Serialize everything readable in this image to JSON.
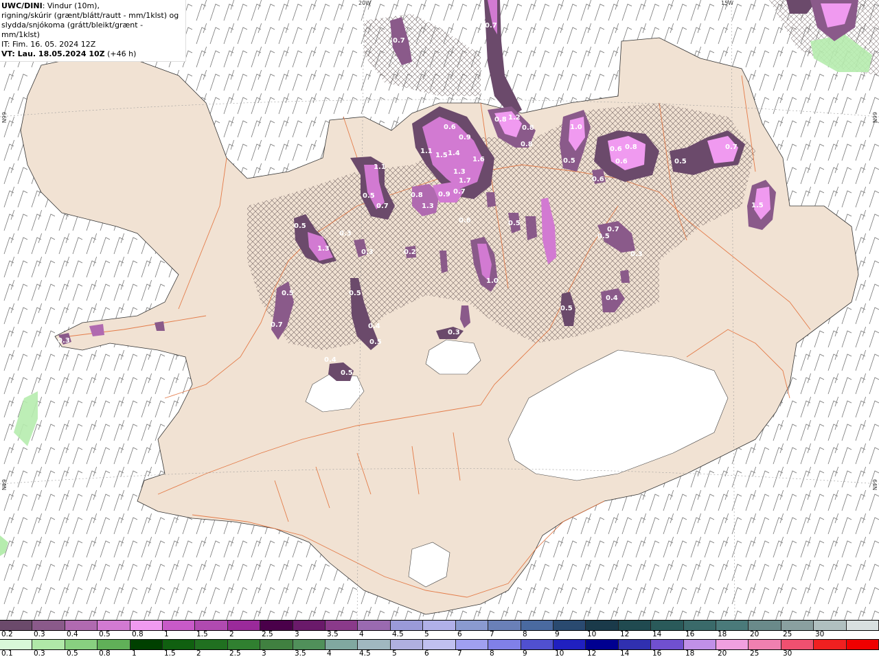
{
  "info": {
    "model": "UWC/DINI",
    "line1_rest": ": Vindur (10m),",
    "line2": "rigning/skúrir (grænt/blátt/rautt - mm/1klst) og",
    "line3": "slydda/snjókoma (grátt/bleikt/grænt - mm/1klst)",
    "line4": "IT: Fim. 16. 05. 2024 12Z",
    "vt_label": "VT: Lau. 18.05.2024 10Z",
    "vt_offset": " (+46 h)"
  },
  "grid_labels": {
    "lon_20w": "20W",
    "lon_15w": "15W",
    "lat_66n_left": "66N",
    "lat_66n_right": "66N",
    "lat_64n_left": "64N",
    "lat_64n_right": "64N"
  },
  "precip_labels": [
    {
      "text": "0.7"
    },
    {
      "text": "0.7"
    },
    {
      "text": "0.6"
    },
    {
      "text": "0.9"
    },
    {
      "text": "1.1"
    },
    {
      "text": "1.5"
    },
    {
      "text": "1.4"
    },
    {
      "text": "1.6"
    },
    {
      "text": "1.3"
    },
    {
      "text": "1.7"
    },
    {
      "text": "0.8"
    },
    {
      "text": "1.2"
    },
    {
      "text": "0.8"
    },
    {
      "text": "0.8"
    },
    {
      "text": "1.0"
    },
    {
      "text": "0.5"
    },
    {
      "text": "0.6"
    },
    {
      "text": "0.8"
    },
    {
      "text": "0.6"
    },
    {
      "text": "0.5"
    },
    {
      "text": "0.7"
    },
    {
      "text": "1.1"
    },
    {
      "text": "0.5"
    },
    {
      "text": "0.7"
    },
    {
      "text": "0.8"
    },
    {
      "text": "1.3"
    },
    {
      "text": "0.9"
    },
    {
      "text": "0.7"
    },
    {
      "text": "1.5"
    },
    {
      "text": "0.6"
    },
    {
      "text": "0.5"
    },
    {
      "text": "1.3"
    },
    {
      "text": "0.3"
    },
    {
      "text": "0.5"
    },
    {
      "text": "0.7"
    },
    {
      "text": "0.5"
    },
    {
      "text": "0.4"
    },
    {
      "text": "0.5"
    },
    {
      "text": "0.3"
    },
    {
      "text": "0.4"
    },
    {
      "text": "0.5"
    },
    {
      "text": "0.2"
    },
    {
      "text": "0.3"
    },
    {
      "text": "0.7"
    },
    {
      "text": "0.3"
    },
    {
      "text": "0.4"
    },
    {
      "text": "0.5"
    },
    {
      "text": "1.0"
    },
    {
      "text": "0.6"
    },
    {
      "text": "0.5"
    },
    {
      "text": "0.5"
    },
    {
      "text": "0.3"
    }
  ],
  "legend_top": {
    "colors": [
      "#6b4a6b",
      "#8a5a8a",
      "#b06ab0",
      "#d27ad2",
      "#f09af0",
      "#c85ac8",
      "#b04ab0",
      "#9a2a9a",
      "#4a004a",
      "#6a1a6a",
      "#8a3a8a",
      "#9a6ab0",
      "#9a9ad8",
      "#b0b0e8",
      "#8a9ad0",
      "#6a80b8",
      "#4a6aa0",
      "#2a4a70",
      "#1a3a4a",
      "#204a50",
      "#2a5a5a",
      "#3a6a6a",
      "#4a7a7a",
      "#6a8a8a",
      "#8aa0a0",
      "#b0c0c0",
      "#d8e0e0"
    ],
    "labels": [
      "0.2",
      "0.3",
      "0.4",
      "0.5",
      "0.8",
      "1",
      "1.5",
      "2",
      "2.5",
      "3",
      "3.5",
      "4",
      "4.5",
      "5",
      "6",
      "7",
      "8",
      "9",
      "10",
      "12",
      "14",
      "16",
      "18",
      "20",
      "25",
      "30"
    ]
  },
  "legend_bottom": {
    "colors": [
      "#d8f8d8",
      "#b0e8a8",
      "#88d080",
      "#60b058",
      "#004000",
      "#106010",
      "#207020",
      "#308030",
      "#408040",
      "#50905a",
      "#80a8a0",
      "#a0b8c0",
      "#b0b0e0",
      "#c0c0f0",
      "#a0a0f0",
      "#8080e8",
      "#5050d0",
      "#2020c0",
      "#000090",
      "#3030b0",
      "#7050d0",
      "#c090e8",
      "#f0a0e0",
      "#f080b0",
      "#f05070",
      "#f02020",
      "#f00000"
    ],
    "labels": [
      "0.1",
      "0.3",
      "0.5",
      "0.8",
      "1",
      "1.5",
      "2",
      "2.5",
      "3",
      "3.5",
      "4",
      "4.5",
      "5",
      "6",
      "7",
      "8",
      "9",
      "10",
      "12",
      "14",
      "16",
      "18",
      "20",
      "25",
      "30"
    ]
  }
}
